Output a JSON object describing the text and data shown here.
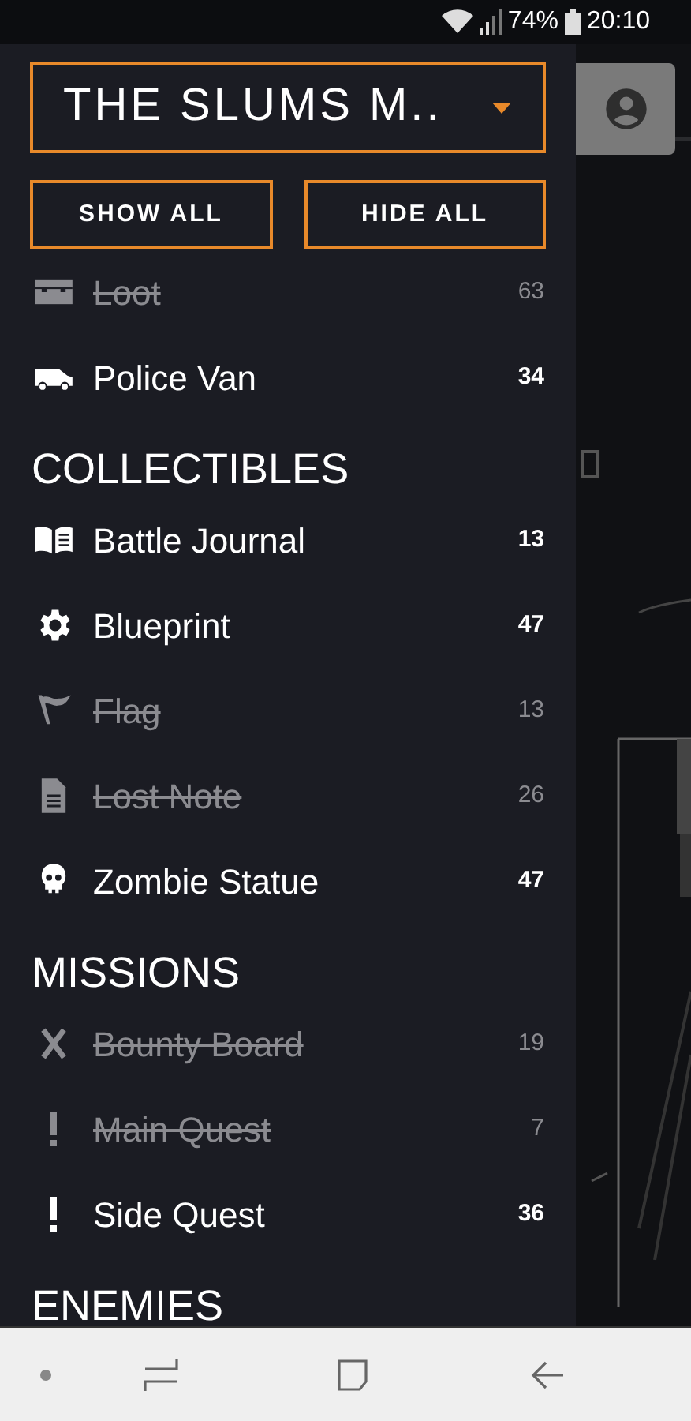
{
  "status_bar": {
    "battery": "74%",
    "time": "20:10"
  },
  "map_selector": {
    "label": "THE SLUMS M.."
  },
  "buttons": [
    {
      "label": "SHOW ALL"
    },
    {
      "label": "HIDE ALL"
    }
  ],
  "sections": [
    {
      "items": [
        {
          "kind": "chest",
          "label": "Loot",
          "count": "63",
          "hidden": true
        },
        {
          "kind": "van",
          "label": "Police Van",
          "count": "34",
          "hidden": false
        }
      ]
    },
    {
      "title": "COLLECTIBLES",
      "items": [
        {
          "kind": "book",
          "label": "Battle Journal",
          "count": "13",
          "hidden": false
        },
        {
          "kind": "gear",
          "label": "Blueprint",
          "count": "47",
          "hidden": false
        },
        {
          "kind": "flag",
          "label": "Flag",
          "count": "13",
          "hidden": true
        },
        {
          "kind": "note",
          "label": "Lost Note",
          "count": "26",
          "hidden": true
        },
        {
          "kind": "skull",
          "label": "Zombie Statue",
          "count": "47",
          "hidden": false
        }
      ]
    },
    {
      "title": "MISSIONS",
      "items": [
        {
          "kind": "cross",
          "label": "Bounty Board",
          "count": "19",
          "hidden": true
        },
        {
          "kind": "exclaim",
          "label": "Main Quest",
          "count": "7",
          "hidden": true
        },
        {
          "kind": "exclaim",
          "label": "Side Quest",
          "count": "36",
          "hidden": false
        }
      ]
    },
    {
      "title": "ENEMIES"
    }
  ]
}
